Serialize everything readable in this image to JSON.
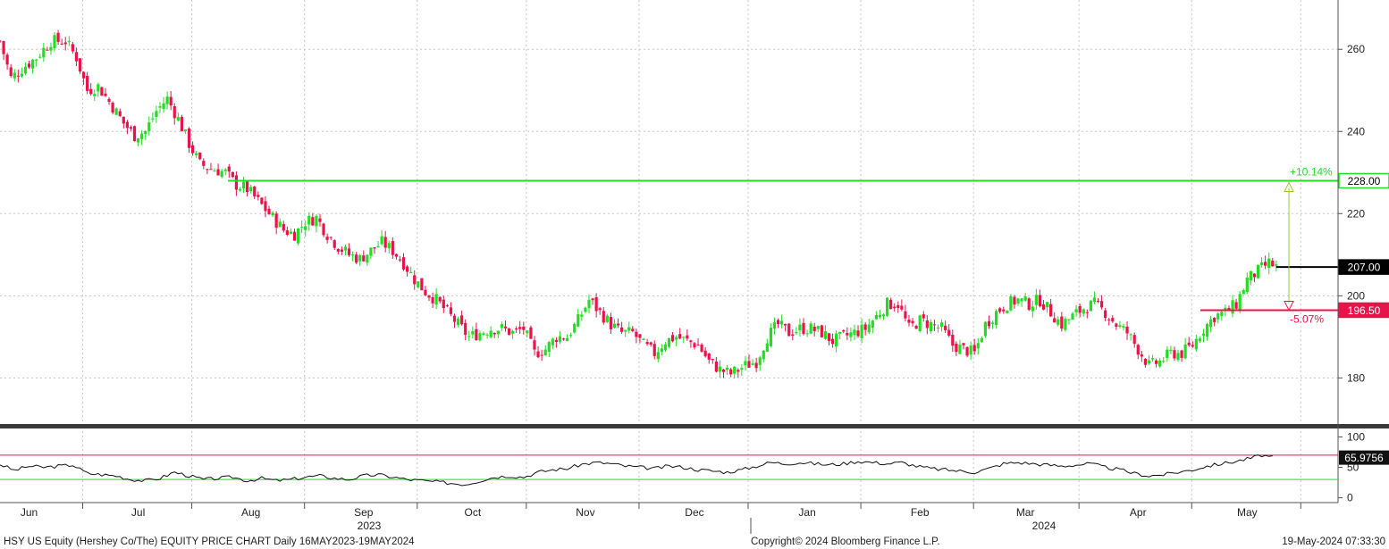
{
  "chart_data": {
    "type": "candlestick",
    "ylim": [
      169,
      272
    ],
    "colors": {
      "up": "#22dd22",
      "down": "#e8134a",
      "grid": "#c8c8c8"
    },
    "y_ticks": [
      180,
      200,
      220,
      240,
      260
    ],
    "x_months": [
      {
        "label": "Jun",
        "day": 8
      },
      {
        "label": "Jul",
        "day": 38
      },
      {
        "label": "Aug",
        "day": 69
      },
      {
        "label": "Sep",
        "day": 100
      },
      {
        "label": "Oct",
        "day": 130
      },
      {
        "label": "Nov",
        "day": 161
      },
      {
        "label": "Dec",
        "day": 191
      },
      {
        "label": "Jan",
        "day": 222
      },
      {
        "label": "Feb",
        "day": 253
      },
      {
        "label": "Mar",
        "day": 282
      },
      {
        "label": "Apr",
        "day": 313
      },
      {
        "label": "May",
        "day": 343
      }
    ],
    "years": [
      "2023",
      "2024"
    ],
    "anchors": [
      [
        0,
        262
      ],
      [
        3,
        253
      ],
      [
        7,
        256
      ],
      [
        10,
        258
      ],
      [
        14,
        262
      ],
      [
        18,
        262
      ],
      [
        21,
        258
      ],
      [
        24,
        250
      ],
      [
        27,
        251
      ],
      [
        31,
        246
      ],
      [
        34,
        242
      ],
      [
        37,
        239
      ],
      [
        40,
        240
      ],
      [
        43,
        245
      ],
      [
        46,
        248
      ],
      [
        49,
        243
      ],
      [
        52,
        237
      ],
      [
        55,
        232
      ],
      [
        58,
        231
      ],
      [
        62,
        230
      ],
      [
        65,
        227
      ],
      [
        68,
        226
      ],
      [
        72,
        222
      ],
      [
        75,
        219
      ],
      [
        78,
        216
      ],
      [
        81,
        215
      ],
      [
        84,
        218
      ],
      [
        87,
        219
      ],
      [
        90,
        215
      ],
      [
        93,
        212
      ],
      [
        96,
        210
      ],
      [
        99,
        209
      ],
      [
        102,
        211
      ],
      [
        105,
        213
      ],
      [
        108,
        211
      ],
      [
        111,
        208
      ],
      [
        114,
        204
      ],
      [
        117,
        201
      ],
      [
        120,
        199
      ],
      [
        123,
        196
      ],
      [
        126,
        193
      ],
      [
        129,
        190
      ],
      [
        132,
        191
      ],
      [
        135,
        192
      ],
      [
        138,
        192
      ],
      [
        141,
        191
      ],
      [
        144,
        192
      ],
      [
        147,
        186
      ],
      [
        150,
        187
      ],
      [
        153,
        190
      ],
      [
        156,
        190
      ],
      [
        159,
        194
      ],
      [
        162,
        199
      ],
      [
        165,
        196
      ],
      [
        168,
        193
      ],
      [
        171,
        191
      ],
      [
        174,
        191
      ],
      [
        177,
        188
      ],
      [
        180,
        186
      ],
      [
        183,
        189
      ],
      [
        186,
        190
      ],
      [
        189,
        189
      ],
      [
        192,
        188
      ],
      [
        195,
        184
      ],
      [
        198,
        182
      ],
      [
        201,
        181
      ],
      [
        205,
        183
      ],
      [
        208,
        184
      ],
      [
        211,
        190
      ],
      [
        214,
        193
      ],
      [
        217,
        191
      ],
      [
        220,
        192
      ],
      [
        223,
        192
      ],
      [
        226,
        191
      ],
      [
        229,
        189
      ],
      [
        232,
        190
      ],
      [
        235,
        191
      ],
      [
        238,
        192
      ],
      [
        241,
        195
      ],
      [
        244,
        198
      ],
      [
        247,
        198
      ],
      [
        250,
        192
      ],
      [
        253,
        194
      ],
      [
        256,
        193
      ],
      [
        259,
        192
      ],
      [
        262,
        188
      ],
      [
        265,
        187
      ],
      [
        268,
        186
      ],
      [
        271,
        193
      ],
      [
        274,
        196
      ],
      [
        277,
        198
      ],
      [
        280,
        199
      ],
      [
        283,
        198
      ],
      [
        286,
        199
      ],
      [
        289,
        196
      ],
      [
        292,
        193
      ],
      [
        295,
        195
      ],
      [
        298,
        197
      ],
      [
        301,
        198
      ],
      [
        304,
        196
      ],
      [
        307,
        193
      ],
      [
        310,
        191
      ],
      [
        313,
        187
      ],
      [
        316,
        183
      ],
      [
        319,
        184
      ],
      [
        322,
        186
      ],
      [
        325,
        186
      ],
      [
        328,
        188
      ],
      [
        331,
        192
      ],
      [
        334,
        195
      ],
      [
        337,
        196
      ],
      [
        340,
        198
      ],
      [
        343,
        204
      ],
      [
        346,
        206
      ],
      [
        349,
        208
      ],
      [
        351,
        207
      ]
    ],
    "lines": [
      {
        "value": 228.0,
        "label": "228.00",
        "pct": "+10.14%",
        "color": "#22dd22"
      },
      {
        "value": 207.0,
        "label": "207.00",
        "color": "#000000"
      },
      {
        "value": 196.5,
        "label": "196.50",
        "pct": "-5.07%",
        "color": "#e8134a"
      }
    ],
    "rsi": {
      "ylim": [
        -5,
        108
      ],
      "ticks": [
        0,
        50,
        100
      ],
      "upper": 70,
      "lower": 30,
      "last_label": "65.9756",
      "anchors": [
        [
          0,
          55
        ],
        [
          4,
          45
        ],
        [
          8,
          52
        ],
        [
          12,
          50
        ],
        [
          16,
          52
        ],
        [
          20,
          54
        ],
        [
          24,
          40
        ],
        [
          28,
          38
        ],
        [
          32,
          36
        ],
        [
          36,
          30
        ],
        [
          40,
          28
        ],
        [
          44,
          32
        ],
        [
          48,
          42
        ],
        [
          52,
          36
        ],
        [
          56,
          30
        ],
        [
          60,
          32
        ],
        [
          64,
          34
        ],
        [
          68,
          28
        ],
        [
          72,
          32
        ],
        [
          76,
          28
        ],
        [
          80,
          30
        ],
        [
          84,
          34
        ],
        [
          88,
          36
        ],
        [
          92,
          32
        ],
        [
          96,
          30
        ],
        [
          100,
          36
        ],
        [
          104,
          38
        ],
        [
          108,
          34
        ],
        [
          112,
          30
        ],
        [
          116,
          28
        ],
        [
          120,
          26
        ],
        [
          124,
          24
        ],
        [
          128,
          22
        ],
        [
          132,
          28
        ],
        [
          136,
          34
        ],
        [
          140,
          36
        ],
        [
          144,
          34
        ],
        [
          148,
          42
        ],
        [
          152,
          46
        ],
        [
          156,
          48
        ],
        [
          160,
          55
        ],
        [
          164,
          58
        ],
        [
          168,
          56
        ],
        [
          172,
          52
        ],
        [
          176,
          50
        ],
        [
          180,
          48
        ],
        [
          184,
          52
        ],
        [
          188,
          50
        ],
        [
          192,
          46
        ],
        [
          196,
          44
        ],
        [
          200,
          42
        ],
        [
          204,
          46
        ],
        [
          208,
          52
        ],
        [
          212,
          58
        ],
        [
          216,
          56
        ],
        [
          220,
          58
        ],
        [
          224,
          56
        ],
        [
          228,
          54
        ],
        [
          232,
          56
        ],
        [
          236,
          60
        ],
        [
          240,
          58
        ],
        [
          244,
          56
        ],
        [
          248,
          58
        ],
        [
          252,
          52
        ],
        [
          256,
          48
        ],
        [
          260,
          46
        ],
        [
          264,
          44
        ],
        [
          268,
          42
        ],
        [
          272,
          48
        ],
        [
          276,
          56
        ],
        [
          280,
          58
        ],
        [
          284,
          56
        ],
        [
          288,
          54
        ],
        [
          292,
          52
        ],
        [
          296,
          54
        ],
        [
          300,
          56
        ],
        [
          304,
          50
        ],
        [
          308,
          46
        ],
        [
          312,
          40
        ],
        [
          316,
          36
        ],
        [
          320,
          38
        ],
        [
          324,
          42
        ],
        [
          328,
          46
        ],
        [
          332,
          52
        ],
        [
          336,
          56
        ],
        [
          340,
          60
        ],
        [
          344,
          65
        ],
        [
          347,
          70
        ],
        [
          350,
          66
        ]
      ]
    }
  },
  "footer": {
    "left": "HSY US Equity (Hershey Co/The) EQUITY PRICE CHART  Daily 16MAY2023-19MAY2024",
    "center": "Copyright© 2024 Bloomberg Finance L.P.",
    "right": "19-May-2024 07:33:30"
  }
}
